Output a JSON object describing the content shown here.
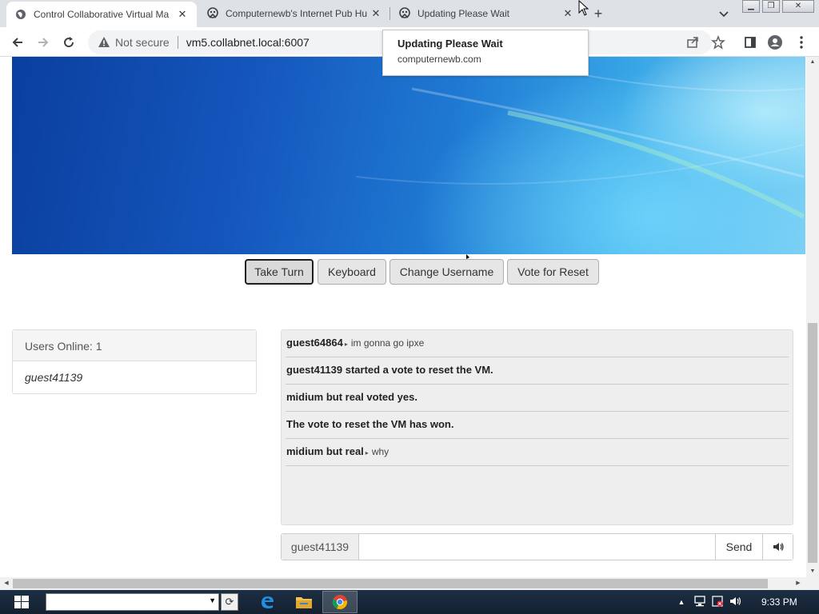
{
  "browser": {
    "tabs": [
      {
        "title": "Control Collaborative Virtual Ma",
        "active": true
      },
      {
        "title": "Computernewb's Internet Pub Hu",
        "active": false
      },
      {
        "title": "Updating Please Wait",
        "active": false
      }
    ],
    "new_tab": "+",
    "address": {
      "security_label": "Not secure",
      "url": "vm5.collabnet.local:6007"
    },
    "hover_card": {
      "title": "Updating Please Wait",
      "host": "computernewb.com"
    }
  },
  "vm": {
    "buttons": {
      "take_turn": "Take Turn",
      "keyboard": "Keyboard",
      "change_username": "Change Username",
      "vote_reset": "Vote for Reset"
    }
  },
  "users_panel": {
    "header": "Users Online: 1",
    "users": [
      "guest41139"
    ]
  },
  "chat": {
    "messages": [
      {
        "user": "guest64864",
        "text": "im gonna go ipxe"
      },
      {
        "system": "guest41139 started a vote to reset the VM."
      },
      {
        "system": "midium but real voted yes."
      },
      {
        "system": "The vote to reset the VM has won."
      },
      {
        "user": "midium but real",
        "text": "why"
      }
    ],
    "input": {
      "username": "guest41139",
      "value": "",
      "send_label": "Send"
    }
  },
  "taskbar": {
    "search_value": "",
    "refresh_glyph": "⟳",
    "clock": "9:33 PM"
  },
  "colors": {
    "tabstrip": "#dee1e6",
    "chat_bg": "#eeeeee",
    "button_bg": "#e6e6e6",
    "taskbar": "#1c2f44"
  }
}
